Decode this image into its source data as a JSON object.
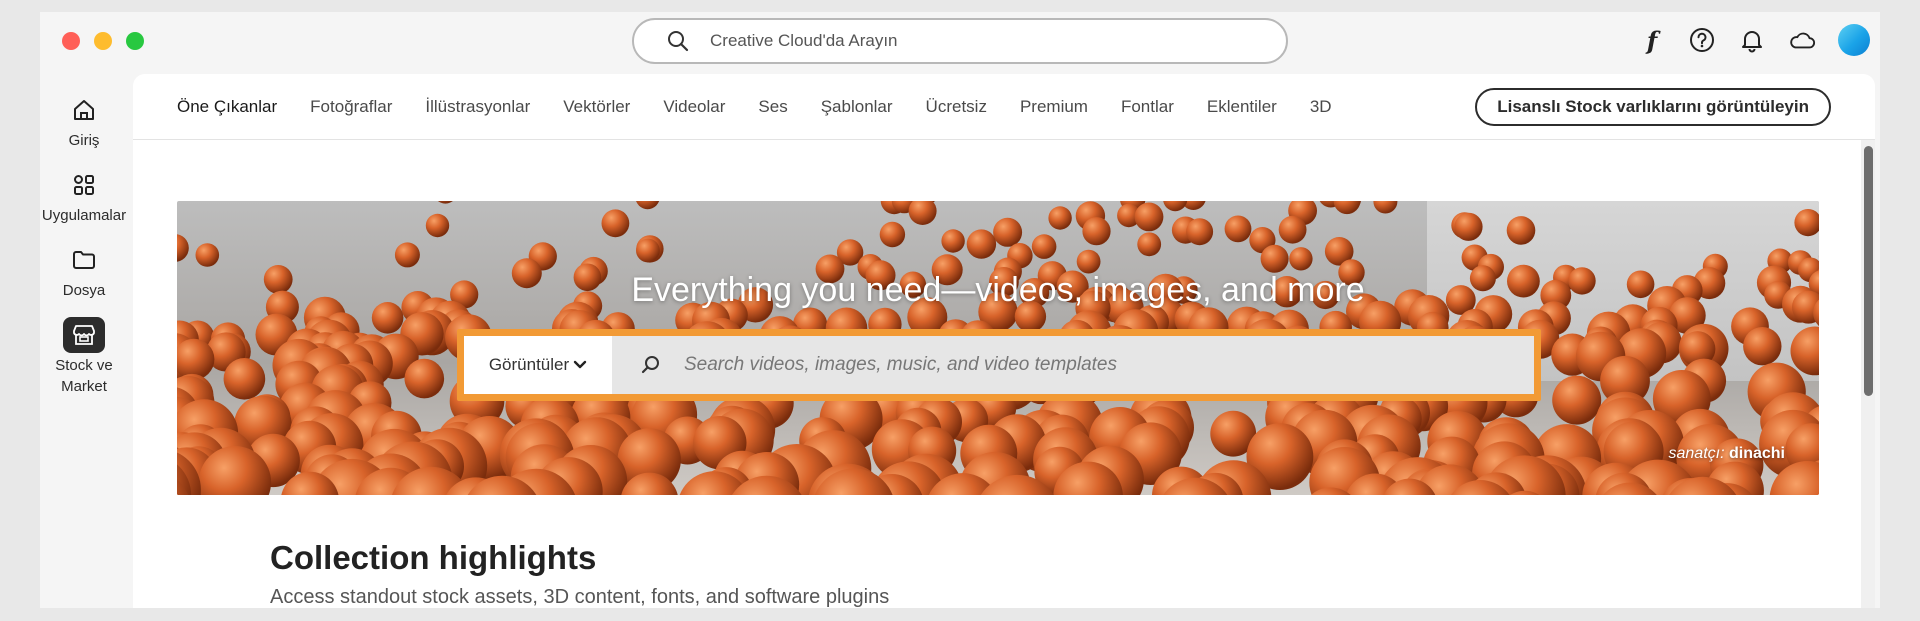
{
  "global_search": {
    "placeholder": "Creative Cloud'da Arayın"
  },
  "top_icons": [
    "fonts-icon",
    "help-icon",
    "bell-icon",
    "cloud-icon",
    "avatar"
  ],
  "rail": {
    "items": [
      {
        "label": "Giriş",
        "icon": "home-icon"
      },
      {
        "label": "Uygulamalar",
        "icon": "apps-icon"
      },
      {
        "label": "Dosya",
        "icon": "folder-icon"
      },
      {
        "label": "Stock ve Market",
        "icon": "stock-market-icon",
        "active": true
      }
    ]
  },
  "tabs": [
    {
      "label": "Öne Çıkanlar",
      "active": true
    },
    {
      "label": "Fotoğraflar"
    },
    {
      "label": "İllüstrasyonlar"
    },
    {
      "label": "Vektörler"
    },
    {
      "label": "Videolar"
    },
    {
      "label": "Ses"
    },
    {
      "label": "Şablonlar"
    },
    {
      "label": "Ücretsiz"
    },
    {
      "label": "Premium"
    },
    {
      "label": "Fontlar"
    },
    {
      "label": "Eklentiler"
    },
    {
      "label": "3D"
    }
  ],
  "license_button": "Lisanslı Stock varlıklarını görüntüleyin",
  "hero": {
    "title": "Everything you need—videos, images, and more",
    "search_type": "Görüntüler",
    "search_placeholder": "Search videos, images, music, and video templates",
    "credit_prefix": "sanatçı:",
    "credit_artist": "dinachi"
  },
  "section": {
    "title": "Collection highlights",
    "subtitle": "Access standout stock assets, 3D content, fonts, and software plugins"
  },
  "colors": {
    "accent_orange": "#f29a35",
    "ball_orange": "#d8632a",
    "avatar_blue": "#1aa3e8"
  }
}
